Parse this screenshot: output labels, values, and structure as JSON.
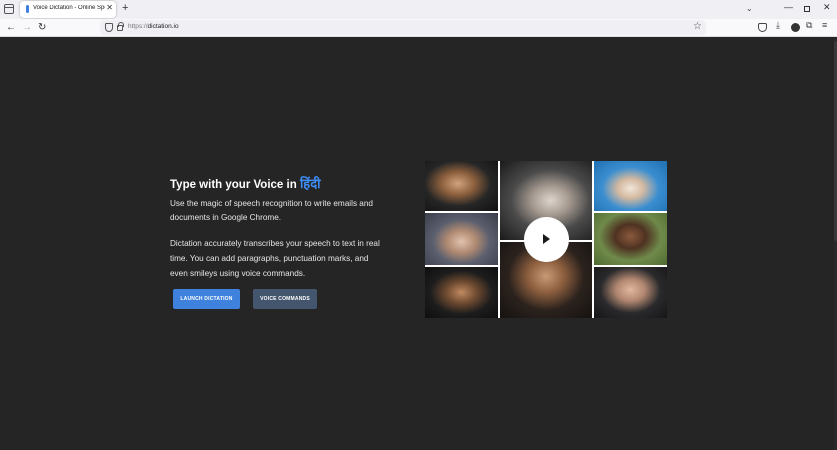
{
  "browser": {
    "tab_title": "Voice Dictation - Online Speech",
    "tab_close": "✕",
    "new_tab": "+",
    "tabs_menu": "⌄",
    "url_protocol": "https://",
    "url_host": "dictation.io",
    "bookmark_star": "☆",
    "window_controls": {
      "minimize": "—",
      "close": "✕"
    },
    "nav": {
      "back": "←",
      "forward": "→",
      "reload": "↻"
    },
    "toolbar_icons": {
      "download": "⤓",
      "extensions": "⧉",
      "menu": "≡"
    }
  },
  "hero": {
    "title_prefix": "Type with your Voice in ",
    "title_language": "हिंदी",
    "paragraph_1": "Use the magic of speech recognition to write emails and documents in Google Chrome.",
    "paragraph_2": "Dictation accurately transcribes your speech to text in real time. You can add paragraphs, punctuation marks, and even smileys using voice commands.",
    "launch_button": "LAUNCH DICTATION",
    "commands_button": "VOICE COMMANDS"
  },
  "colors": {
    "page_background": "#252525",
    "accent_blue": "#3f82de",
    "language_text": "#3e8ef7",
    "secondary_button": "#44556e"
  },
  "collage": {
    "play_icon": "play-icon",
    "portraits": 8
  }
}
